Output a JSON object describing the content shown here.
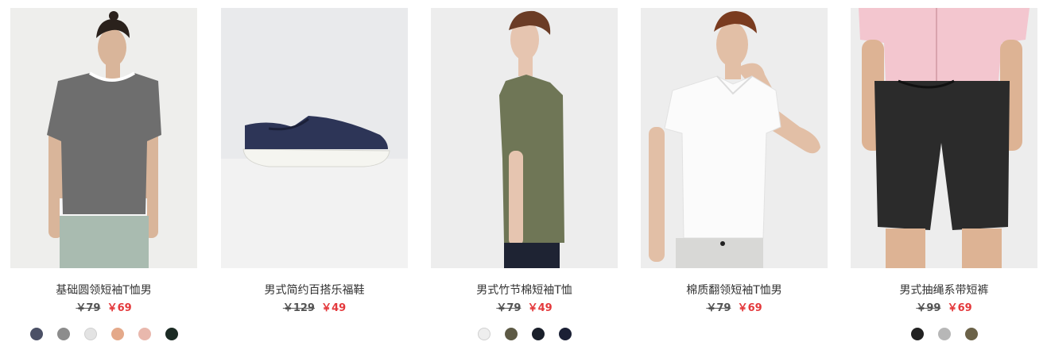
{
  "products": [
    {
      "name": "基础圆领短袖T恤男",
      "original_price": "￥79",
      "sale_price": "￥69",
      "swatches": [
        "#4b5066",
        "#8c8c8c",
        "#e3e3e3",
        "#e4a98a",
        "#e9b8ad",
        "#1c2b24"
      ]
    },
    {
      "name": "男式简约百搭乐福鞋",
      "original_price": "￥129",
      "sale_price": "￥49",
      "swatches": []
    },
    {
      "name": "男式竹节棉短袖T恤",
      "original_price": "￥79",
      "sale_price": "￥49",
      "swatches": [
        "#eeeeee",
        "#5d5a45",
        "#1a1f2a",
        "#1b2035"
      ]
    },
    {
      "name": "棉质翻领短袖T恤男",
      "original_price": "￥79",
      "sale_price": "￥69",
      "swatches": []
    },
    {
      "name": "男式抽绳系带短裤",
      "original_price": "￥99",
      "sale_price": "￥69",
      "swatches": [
        "#222222",
        "#b7b7b7",
        "#6b6248"
      ]
    }
  ],
  "colors": {
    "sale_price": "#e4393c",
    "text": "#333333",
    "tile_bg": "#ededed"
  }
}
